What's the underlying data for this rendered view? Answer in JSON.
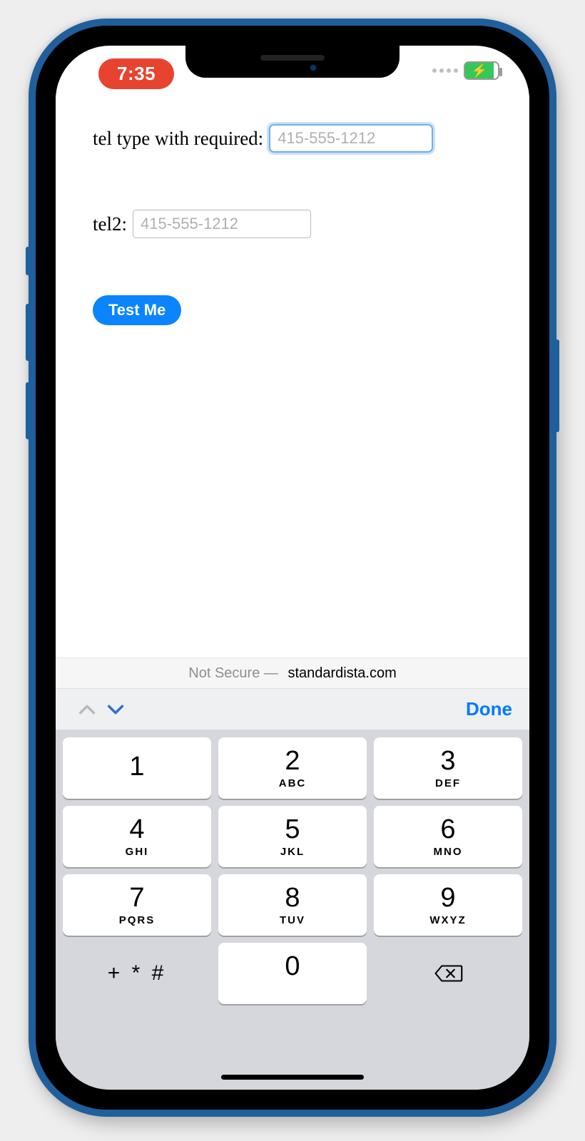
{
  "status": {
    "time": "7:35",
    "battery_color": "#34c759"
  },
  "form": {
    "row1": {
      "label": "tel type with required:",
      "placeholder": "415-555-1212",
      "value": ""
    },
    "row2": {
      "label": "tel2:",
      "placeholder": "415-555-1212",
      "value": ""
    },
    "button_label": "Test Me"
  },
  "urlbar": {
    "prefix": "Not Secure —",
    "domain": "standardista.com"
  },
  "accessory": {
    "done": "Done"
  },
  "keypad": {
    "keys": [
      [
        {
          "d": "1",
          "l": ""
        },
        {
          "d": "2",
          "l": "ABC"
        },
        {
          "d": "3",
          "l": "DEF"
        }
      ],
      [
        {
          "d": "4",
          "l": "GHI"
        },
        {
          "d": "5",
          "l": "JKL"
        },
        {
          "d": "6",
          "l": "MNO"
        }
      ],
      [
        {
          "d": "7",
          "l": "PQRS"
        },
        {
          "d": "8",
          "l": "TUV"
        },
        {
          "d": "9",
          "l": "WXYZ"
        }
      ]
    ],
    "symbols": "+ * #",
    "zero": "0"
  }
}
